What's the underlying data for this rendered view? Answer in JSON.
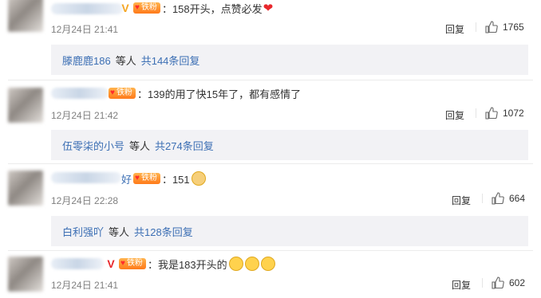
{
  "comments": [
    {
      "fan_badge": "铁粉",
      "content": "：158开头，点赞必发",
      "content_emoji": "heart",
      "timestamp": "12月24日 21:41",
      "reply_label": "回复",
      "likes": "1765",
      "replies": {
        "who": "滕鹿鹿186",
        "etc": "等人",
        "total": "共144条回复"
      }
    },
    {
      "fan_badge": "铁粉",
      "content": "：139的用了快15年了，都有感情了",
      "timestamp": "12月24日 21:42",
      "reply_label": "回复",
      "likes": "1072",
      "replies": {
        "who": "伍零柒的小号",
        "etc": "等人",
        "total": "共274条回复"
      }
    },
    {
      "name_fragment": "好",
      "fan_badge": "铁粉",
      "content": "：151",
      "content_emoji": "dog",
      "timestamp": "12月24日 22:28",
      "reply_label": "回复",
      "likes": "664",
      "replies": {
        "who": "白利强吖",
        "etc": "等人",
        "total": "共128条回复"
      }
    },
    {
      "fan_badge": "铁粉",
      "content": "：我是183开头的",
      "content_emoji": "laugh-cry x3",
      "timestamp": "12月24日 21:41",
      "reply_label": "回复",
      "likes": "602"
    }
  ],
  "colors": {
    "link": "#3c6fb4",
    "badge": "#ff8a1f",
    "reply_bg": "#f2f2f5",
    "time": "#808080"
  }
}
